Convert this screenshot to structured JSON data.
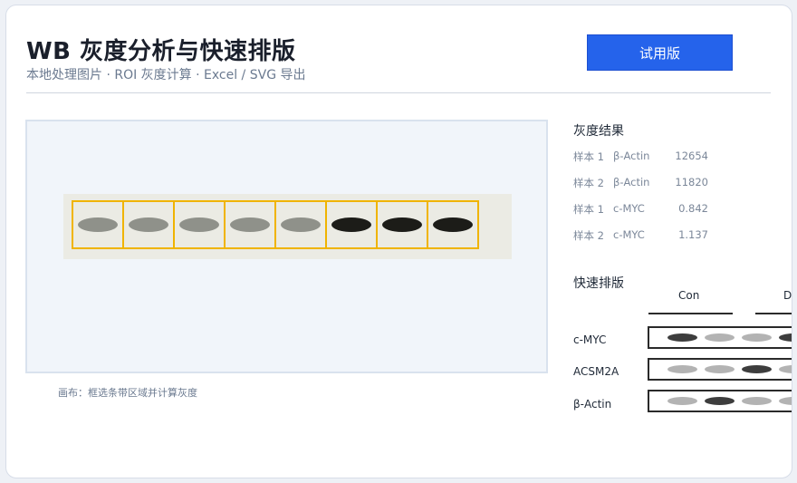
{
  "header": {
    "title": "WB 灰度分析与快速排版",
    "subtitle": "本地处理图片 · ROI 灰度计算 · Excel / SVG 导出",
    "trial_button": "试用版"
  },
  "canvas": {
    "caption": "画布：框选条带区域并计算灰度",
    "bands": [
      "light",
      "light",
      "light",
      "light",
      "light",
      "dark",
      "dark",
      "dark"
    ]
  },
  "results": {
    "title": "灰度结果",
    "rows": [
      {
        "sample": "样本 1",
        "target": "β-Actin",
        "value": "12654"
      },
      {
        "sample": "样本 2",
        "target": "β-Actin",
        "value": "11820"
      },
      {
        "sample": "样本 1",
        "target": "c-MYC",
        "value": "0.842"
      },
      {
        "sample": "样本 2",
        "target": "c-MYC",
        "value": "1.137"
      }
    ]
  },
  "layout_panel": {
    "title": "快速排版",
    "groups": [
      "Con",
      "Dru"
    ],
    "lanes": [
      {
        "label": "c-MYC",
        "bands": [
          "d",
          "l",
          "l",
          "d"
        ]
      },
      {
        "label": "ACSM2A",
        "bands": [
          "l",
          "l",
          "d",
          "l"
        ]
      },
      {
        "label": "β-Actin",
        "bands": [
          "l",
          "d",
          "l",
          "l"
        ]
      }
    ]
  }
}
